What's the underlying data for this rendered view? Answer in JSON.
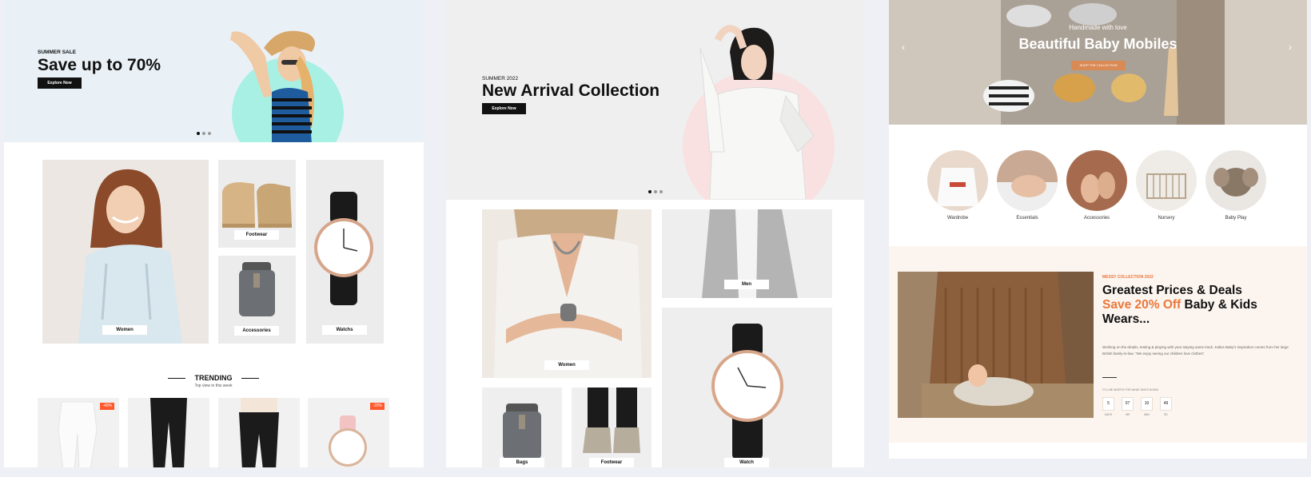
{
  "panel1": {
    "hero": {
      "eyebrow": "SUMMER SALE",
      "title": "Save up to 70%",
      "button_label": "Explore Now",
      "bg_color": "#eaf1f6",
      "accent_circle": "#a8f0e4"
    },
    "categories": [
      {
        "label": "Women"
      },
      {
        "label": "Footwear"
      },
      {
        "label": "Accessories"
      },
      {
        "label": "Watchs"
      }
    ],
    "trending": {
      "title": "TRENDING",
      "subtitle": "Top view in this week"
    },
    "products": [
      {
        "badge": "-40%"
      },
      {
        "badge": ""
      },
      {
        "badge": ""
      },
      {
        "badge": "-20%"
      }
    ]
  },
  "panel2": {
    "hero": {
      "eyebrow": "SUMMER 2022",
      "title": "New Arrival Collection",
      "button_label": "Explore Now",
      "bg_color": "#efefef",
      "accent_circle": "#f9e1e1"
    },
    "categories": [
      {
        "label": "Women"
      },
      {
        "label": "Men"
      },
      {
        "label": "Watch"
      },
      {
        "label": "Bags"
      },
      {
        "label": "Footwear"
      }
    ]
  },
  "panel3": {
    "hero": {
      "eyebrow": "Handmade with love",
      "title": "Beautiful Baby Mobiles",
      "button_label": "SHOP THE COLLECTION",
      "prev_icon": "chevron-left-icon",
      "next_icon": "chevron-right-icon"
    },
    "categories": [
      {
        "label": "Wardrobe"
      },
      {
        "label": "Essentials"
      },
      {
        "label": "Accessories"
      },
      {
        "label": "Nursery"
      },
      {
        "label": "Baby Play"
      }
    ],
    "promo": {
      "eyebrow": "MESSY COLLECTION 2022",
      "title_line1": "Greatest Prices & Deals",
      "highlight": "Save 20% Off",
      "title_line2_rest": " Baby & Kids",
      "title_line3": "Wears...",
      "body": "Working on the details, testing & playing with year staying same track. Kallos Baby's inspiration comes from her large British family-in-law. \"We enjoy seeing our children love clothes\".",
      "timer_caption": "IT'LL BE WORTH FOR WHAT SHE'S DOING",
      "countdown": [
        {
          "value": "5",
          "unit": "DAYS"
        },
        {
          "value": "07",
          "unit": "HR"
        },
        {
          "value": "10",
          "unit": "MIN"
        },
        {
          "value": "49",
          "unit": "SC"
        }
      ],
      "accent_color": "#e9773a",
      "bg_color": "#fcf5ef"
    }
  }
}
